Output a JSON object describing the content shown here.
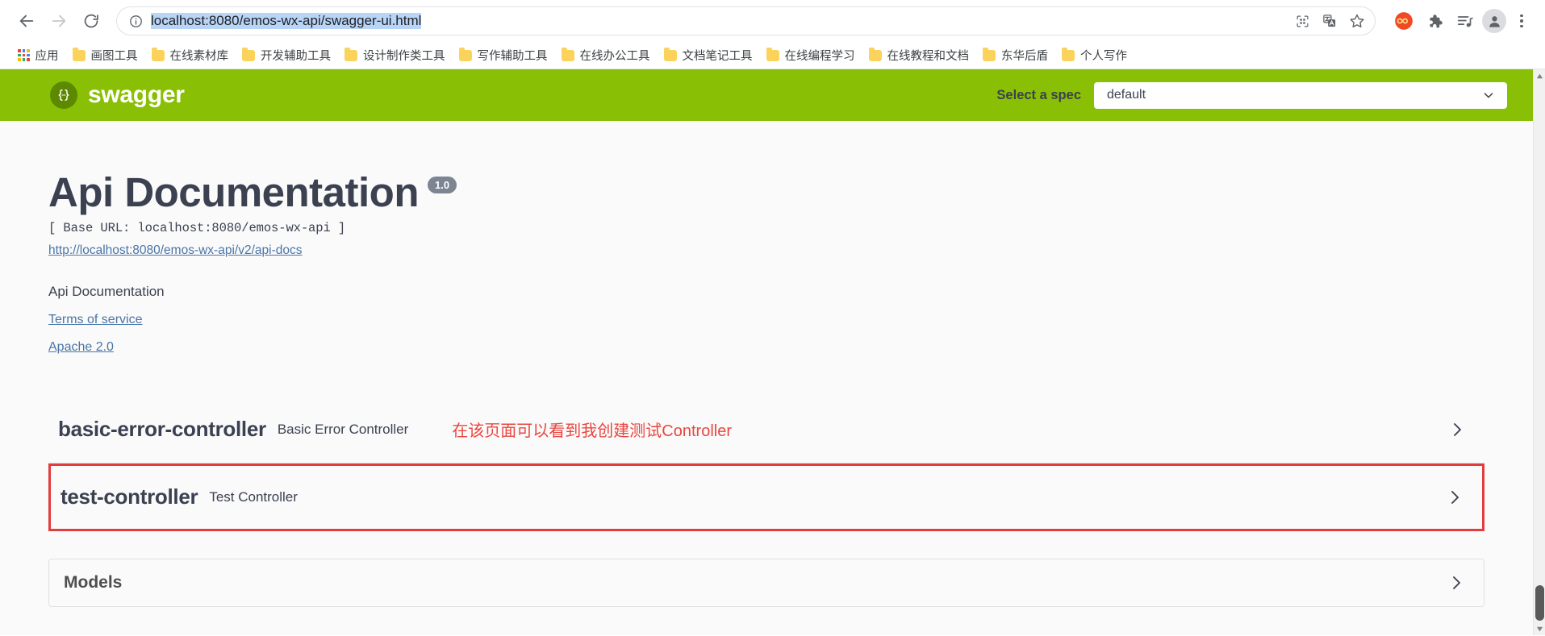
{
  "browser": {
    "nav": {
      "back_icon": "arrow-left-icon",
      "forward_icon": "arrow-right-icon",
      "reload_icon": "reload-icon"
    },
    "omnibox": {
      "site_info_icon": "info-circle-icon",
      "url": "localhost:8080/emos-wx-api/swagger-ui.html",
      "url_selected": true,
      "qr_icon": "qr-code-icon",
      "translate_icon": "translate-icon",
      "bookmark_icon": "star-icon"
    },
    "right_actions": {
      "infinity_icon": "infinity-extension-icon",
      "extensions_icon": "puzzle-piece-icon",
      "playlist_icon": "playlist-music-icon",
      "profile_icon": "account-avatar-icon",
      "menu_icon": "three-dot-menu-icon"
    },
    "bookmarks": {
      "apps_label": "应用",
      "items": [
        {
          "label": "画图工具"
        },
        {
          "label": "在线素材库"
        },
        {
          "label": "开发辅助工具"
        },
        {
          "label": "设计制作类工具"
        },
        {
          "label": "写作辅助工具"
        },
        {
          "label": "在线办公工具"
        },
        {
          "label": "文档笔记工具"
        },
        {
          "label": "在线编程学习"
        },
        {
          "label": "在线教程和文档"
        },
        {
          "label": "东华后盾"
        },
        {
          "label": "个人写作"
        }
      ]
    }
  },
  "swagger": {
    "topbar": {
      "logo_glyph": "{…}",
      "logo_text": "swagger",
      "spec_label": "Select a spec",
      "spec_value": "default",
      "caret_icon": "chevron-down-icon",
      "brand_color": "#89bf04"
    },
    "info": {
      "title": "Api Documentation",
      "version": "1.0",
      "base_url": "[ Base URL: localhost:8080/emos-wx-api ]",
      "api_docs_url": "http://localhost:8080/emos-wx-api/v2/api-docs",
      "description": "Api Documentation",
      "terms_of_service": "Terms of service",
      "license": "Apache 2.0"
    },
    "tags": [
      {
        "name": "basic-error-controller",
        "description": "Basic Error Controller",
        "annotation": "在该页面可以看到我创建测试Controller",
        "highlighted": false,
        "expand_icon": "chevron-right-icon"
      },
      {
        "name": "test-controller",
        "description": "Test Controller",
        "annotation": "",
        "highlighted": true,
        "expand_icon": "chevron-right-icon"
      }
    ],
    "models": {
      "title": "Models",
      "expand_icon": "chevron-right-icon"
    },
    "annotation_color": "#e8473f"
  }
}
